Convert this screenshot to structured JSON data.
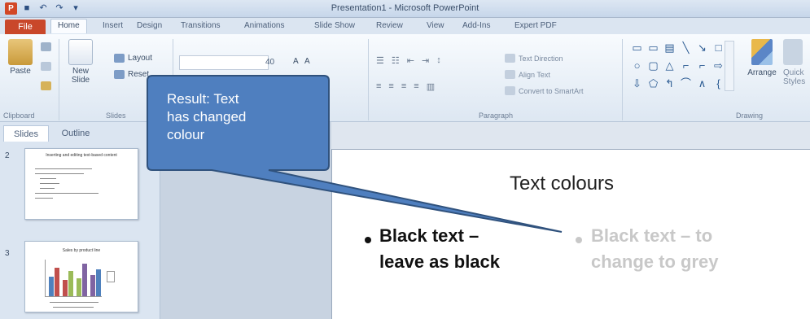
{
  "window": {
    "title": "Presentation1 - Microsoft PowerPoint"
  },
  "tabs": [
    "Home",
    "Insert",
    "Design",
    "Transitions",
    "Animations",
    "Slide Show",
    "Review",
    "View",
    "Add-Ins",
    "Expert PDF"
  ],
  "file_tab": "File",
  "ribbon": {
    "paste": "Paste",
    "new_slide": "New Slide",
    "layout": "Layout",
    "reset": "Reset",
    "font_size": "40",
    "text_direction": "Text Direction",
    "align_text": "Align Text",
    "convert_smartart": "Convert to SmartArt",
    "arrange": "Arrange",
    "quick_styles": "Quick Styles",
    "groups": {
      "clipboard": "Clipboard",
      "slides": "Slides",
      "paragraph": "Paragraph",
      "drawing": "Drawing"
    }
  },
  "pane": {
    "tabs": [
      "Slides",
      "Outline"
    ],
    "close": "×",
    "thumbnails": [
      {
        "number": "2",
        "title": "Inserting and editing text-based content"
      },
      {
        "number": "3",
        "title": "Sales by product line",
        "bars": [
          0.55,
          0.8,
          0.45,
          0.7,
          0.5,
          0.9,
          0.6,
          0.75
        ]
      }
    ]
  },
  "slide": {
    "title": "Text colours",
    "bullet_left": [
      "Black text –",
      "leave as black"
    ],
    "bullet_right": [
      "Black text – to",
      "change to grey"
    ],
    "colors": {
      "left_text": "#111111",
      "right_text": "#c8c8c8"
    }
  },
  "callout": {
    "text": [
      "Result: Text",
      "has changed",
      "colour"
    ],
    "fill": "#4f7fbf",
    "stroke": "#30527d"
  }
}
